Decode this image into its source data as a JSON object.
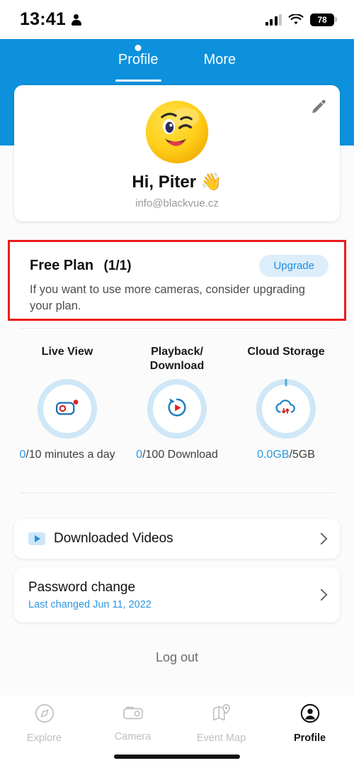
{
  "status_bar": {
    "time": "13:41",
    "person_icon": "person-icon",
    "signal_icon": "signal-bars-icon",
    "wifi_icon": "wifi-icon",
    "battery_level": "78"
  },
  "header": {
    "tabs": [
      {
        "label": "Profile",
        "active": true
      },
      {
        "label": "More",
        "active": false
      }
    ],
    "background_color": "#0d91dc"
  },
  "profile": {
    "avatar_icon": "winking-face-emoji-avatar",
    "edit_icon": "pencil-edit-icon",
    "greeting": "Hi, Piter 👋",
    "email": "info@blackvue.cz"
  },
  "plan": {
    "title": "Free Plan",
    "count": "(1/1)",
    "upgrade_label": "Upgrade",
    "description": "If you want to use more cameras, consider upgrading your plan.",
    "highlight_color": "#ee1c1c",
    "upgrade_bg": "#ddeefb",
    "upgrade_text_color": "#1d8ede"
  },
  "usage": [
    {
      "label": "Live View",
      "icon": "dashcam-record-icon",
      "used": "0",
      "total": "/10 minutes a day"
    },
    {
      "label": "Playback/\nDownload",
      "icon": "rewind-play-icon",
      "used": "0",
      "total": "/100 Download"
    },
    {
      "label": "Cloud Storage",
      "icon": "cloud-sync-icon",
      "used": "0.0GB",
      "total": "/5GB"
    }
  ],
  "rows": {
    "downloads": {
      "icon": "play-video-icon",
      "title": "Downloaded Videos",
      "chevron": "chevron-right-icon"
    },
    "password": {
      "title": "Password change",
      "subtitle": "Last changed Jun 11, 2022",
      "chevron": "chevron-right-icon"
    }
  },
  "logout_label": "Log out",
  "bottom_nav": [
    {
      "label": "Explore",
      "icon": "compass-icon",
      "active": false
    },
    {
      "label": "Camera",
      "icon": "dashcam-icon",
      "active": false
    },
    {
      "label": "Event Map",
      "icon": "map-pin-icon",
      "active": false
    },
    {
      "label": "Profile",
      "icon": "person-circle-icon",
      "active": true
    }
  ]
}
